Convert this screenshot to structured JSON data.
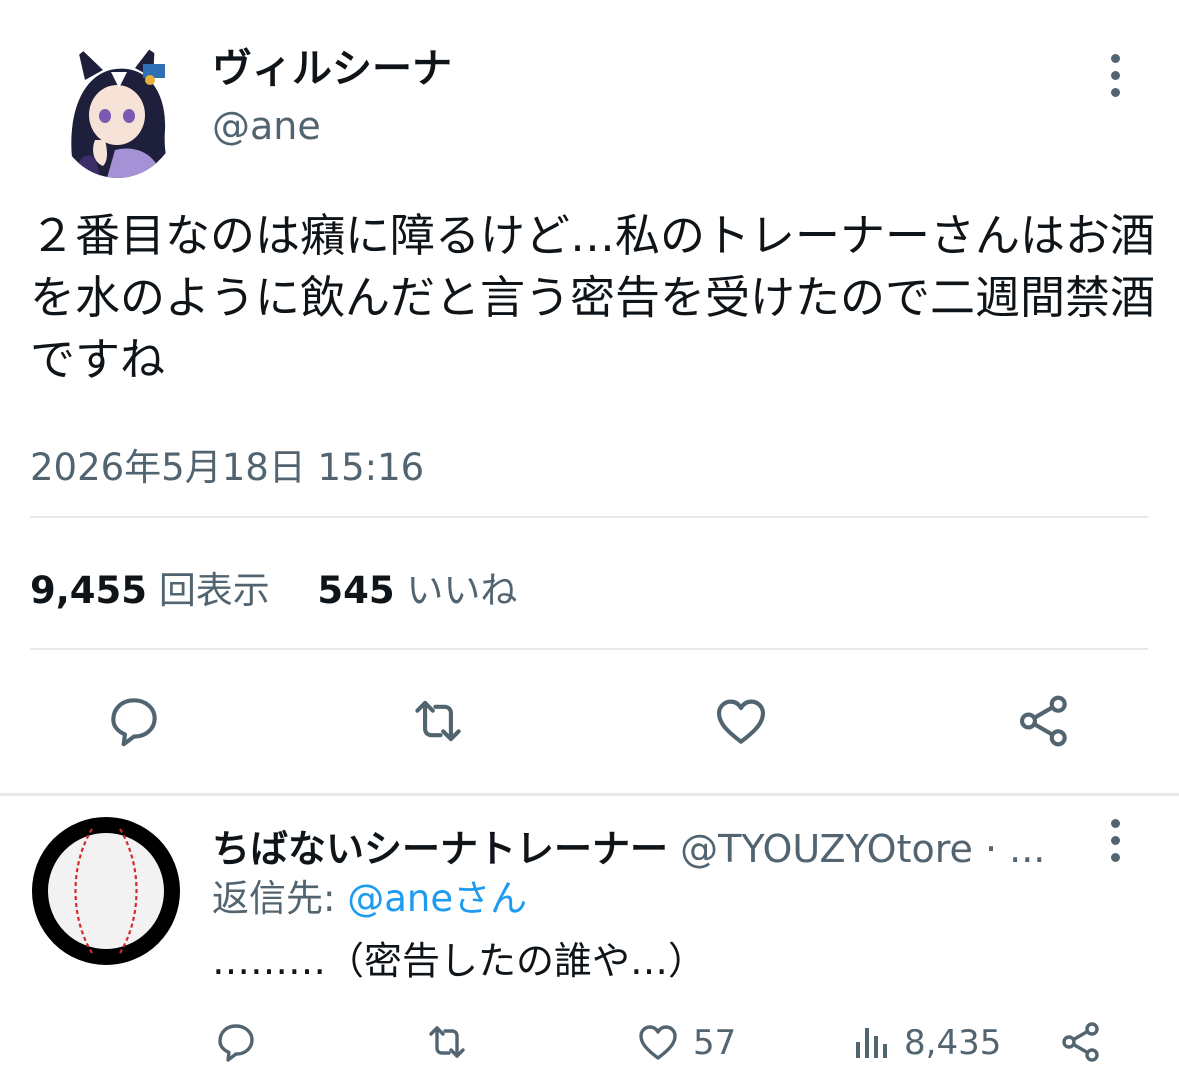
{
  "tweet": {
    "display_name": "ヴィルシーナ",
    "handle": "@ane",
    "text": "２番目なのは癪に障るけど…私のトレーナーさんはお酒を水のように飲んだと言う密告を受けたので二週間禁酒ですね",
    "timestamp": "2026年5月18日 15:16",
    "views_count": "9,455",
    "views_label": "回表示",
    "likes_count": "545",
    "likes_label": "いいね",
    "icons": [
      "reply-icon",
      "retweet-icon",
      "like-icon",
      "share-icon",
      "more-icon"
    ]
  },
  "reply": {
    "display_name": "ちばないシーナトレーナー",
    "handle_time": "@TYOUZYOtore · ...",
    "reply_to_prefix": "返信先: ",
    "reply_to_user": "@aneさん",
    "text": "………（密告したの誰や…）",
    "likes": "57",
    "views": "8,435",
    "icons": [
      "reply-icon",
      "retweet-icon",
      "like-icon",
      "views-icon",
      "share-icon",
      "more-icon"
    ]
  },
  "colors": {
    "text": "#0f1419",
    "secondary": "#536471",
    "link": "#1d9bf0",
    "divider": "#e6e9ec"
  }
}
